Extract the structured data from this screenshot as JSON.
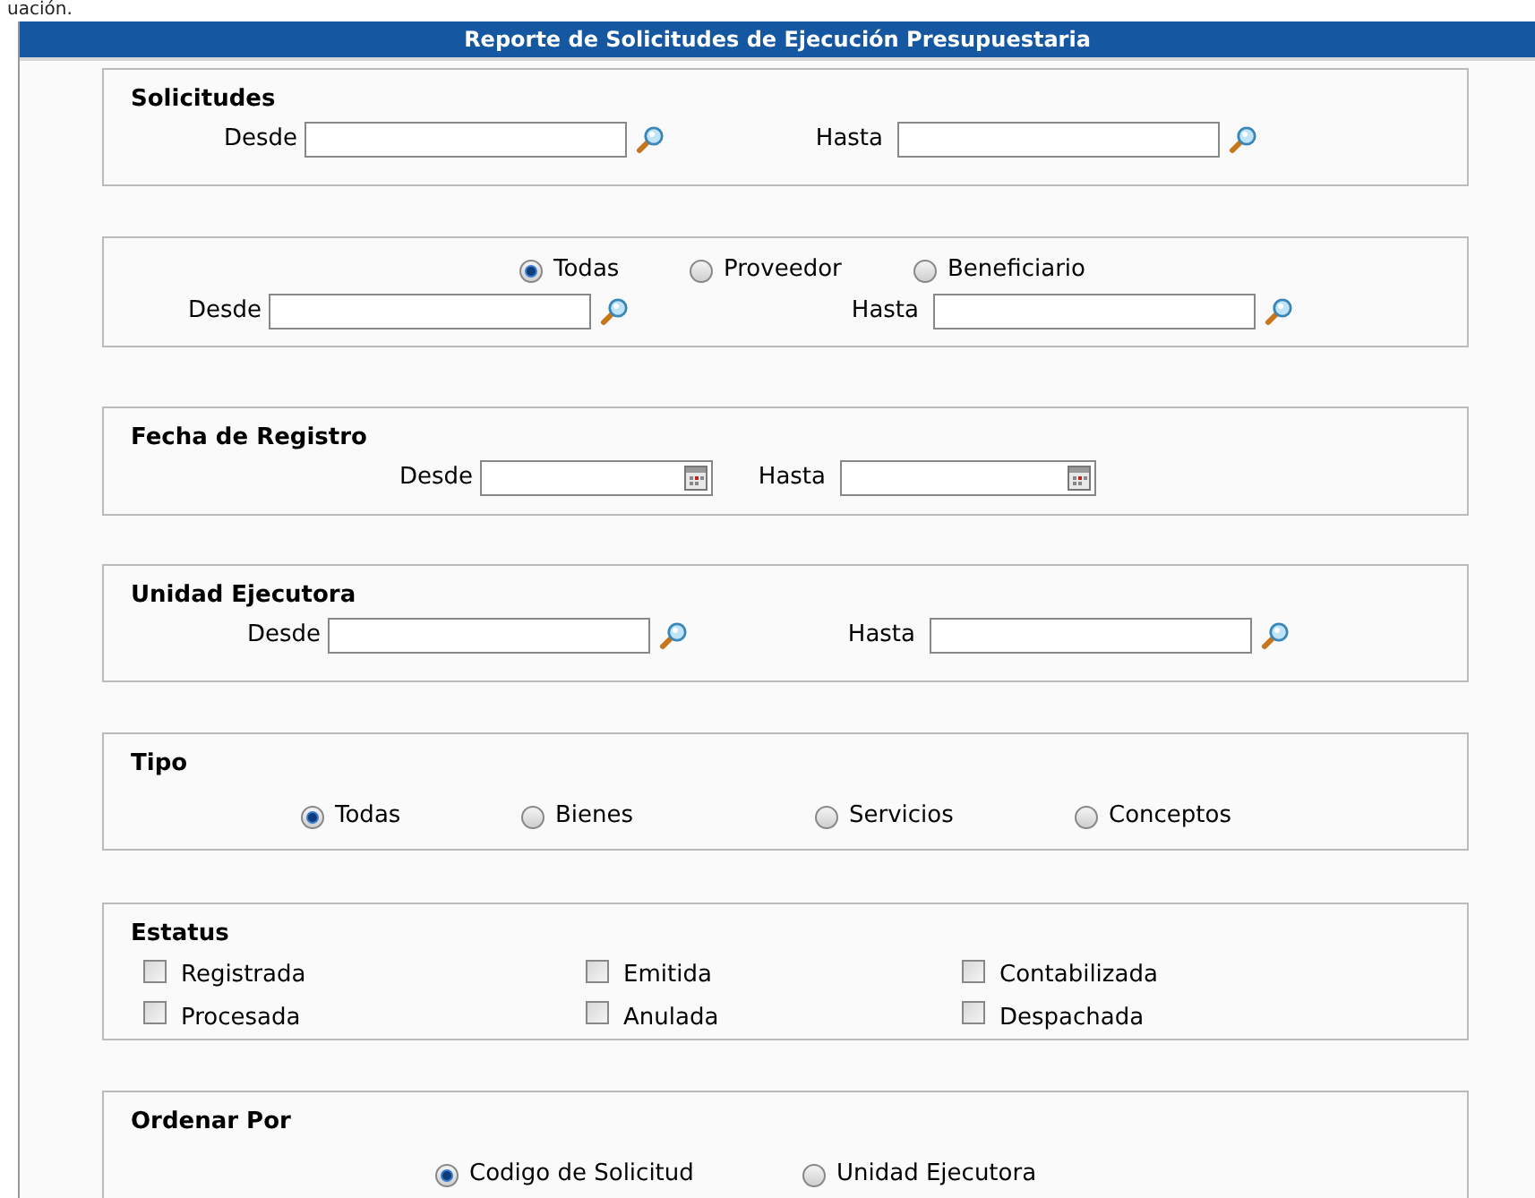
{
  "top_text": "uación.",
  "header": {
    "title": "Reporte de Solicitudes de Ejecución Presupuestaria"
  },
  "sections": [
    {
      "kind": "range",
      "title": "Solicitudes",
      "from_label": "Desde",
      "to_label": "Hasta"
    },
    {
      "kind": "radio_range",
      "options": [
        {
          "label": "Todas",
          "selected": true
        },
        {
          "label": "Proveedor",
          "selected": false
        },
        {
          "label": "Beneficiario",
          "selected": false
        }
      ],
      "from_label": "Desde",
      "to_label": "Hasta"
    },
    {
      "kind": "date_range",
      "title": "Fecha de Registro",
      "from_label": "Desde",
      "to_label": "Hasta"
    },
    {
      "kind": "range",
      "title": "Unidad Ejecutora",
      "from_label": "Desde",
      "to_label": "Hasta"
    },
    {
      "kind": "radios",
      "title": "Tipo",
      "options": [
        {
          "label": "Todas",
          "selected": true
        },
        {
          "label": "Bienes",
          "selected": false
        },
        {
          "label": "Servicios",
          "selected": false
        },
        {
          "label": "Conceptos",
          "selected": false
        }
      ]
    },
    {
      "kind": "checks",
      "title": "Estatus",
      "options": [
        {
          "label": "Registrada",
          "checked": false
        },
        {
          "label": "Emitida",
          "checked": false
        },
        {
          "label": "Contabilizada",
          "checked": false
        },
        {
          "label": "Procesada",
          "checked": false
        },
        {
          "label": "Anulada",
          "checked": false
        },
        {
          "label": "Despachada",
          "checked": false
        }
      ]
    },
    {
      "kind": "radios",
      "title": "Ordenar Por",
      "options": [
        {
          "label": "Codigo de Solicitud",
          "selected": true
        },
        {
          "label": "Unidad Ejecutora",
          "selected": false
        }
      ]
    }
  ]
}
